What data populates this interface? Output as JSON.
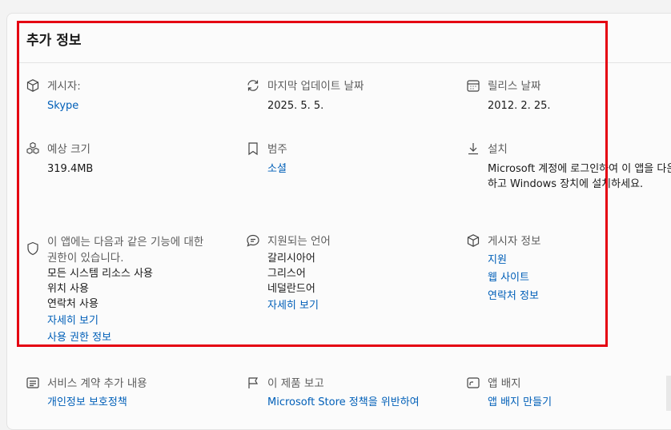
{
  "section": {
    "title": "추가 정보"
  },
  "items": {
    "publisher": {
      "icon": "package-icon",
      "label": "게시자:",
      "value": "Skype"
    },
    "last_update": {
      "icon": "refresh-icon",
      "label": "마지막 업데이트 날짜",
      "value": "2025. 5. 5."
    },
    "release": {
      "icon": "calendar-icon",
      "label": "릴리스 날짜",
      "value": "2012. 2. 25."
    },
    "size": {
      "icon": "cubes-icon",
      "label": "예상 크기",
      "value": "319.4MB"
    },
    "category": {
      "icon": "bookmark-icon",
      "label": "범주",
      "value": "소셜"
    },
    "install": {
      "icon": "download-icon",
      "label": "설치",
      "value": "Microsoft 계정에 로그인하여 이 앱을 다운로드하고 Windows 장치에 설치하세요."
    },
    "permissions": {
      "icon": "shield-icon",
      "label": "이 앱에는 다음과 같은 기능에 대한 권한이 있습니다.",
      "values": [
        "모든 시스템 리소스 사용",
        "위치 사용",
        "연락처 사용"
      ],
      "more_link": "자세히 보기",
      "info_link": "사용 권한 정보"
    },
    "languages": {
      "icon": "chat-icon",
      "label": "지원되는 언어",
      "values": [
        "갈리시아어",
        "그리스어",
        "네덜란드어"
      ],
      "more_link": "자세히 보기"
    },
    "publisher_info": {
      "icon": "package-icon",
      "label": "게시자 정보",
      "links": [
        "지원",
        "웹 사이트",
        "연락처 정보"
      ]
    },
    "terms": {
      "icon": "document-icon",
      "label": "서비스 계약 추가 내용",
      "link": "개인정보 보호정책"
    },
    "report": {
      "icon": "flag-icon",
      "label": "이 제품 보고",
      "link": "Microsoft Store 정책을 위반하여"
    },
    "badge": {
      "icon": "badge-icon",
      "label": "앱 배지",
      "link": "앱 배지 만들기"
    }
  },
  "colors": {
    "link": "#005fb8",
    "highlight": "#e50012",
    "label": "#5c5c5c"
  }
}
